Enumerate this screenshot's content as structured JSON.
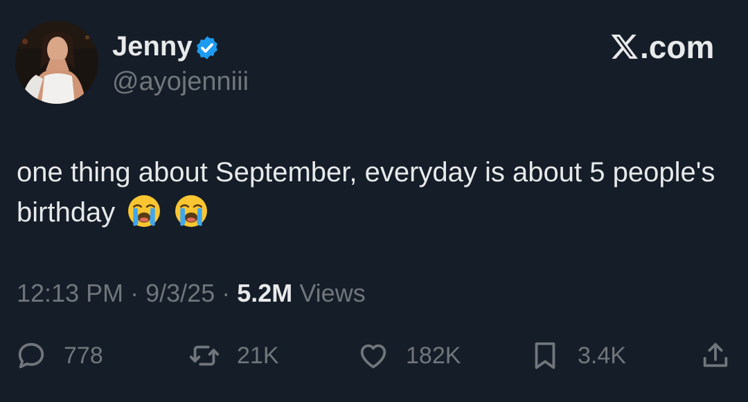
{
  "author": {
    "name": "Jenny",
    "handle": "@ayojenniii"
  },
  "brand": {
    "label": ".com"
  },
  "tweet": {
    "text": "one thing about September, everyday is about 5 people's birthday",
    "emojis": [
      "loudly-crying-face",
      "loudly-crying-face"
    ]
  },
  "meta": {
    "time": "12:13 PM",
    "separator": "·",
    "date": "9/3/25",
    "views_count": "5.2M",
    "views_label": "Views"
  },
  "actions": {
    "replies": "778",
    "reposts": "21K",
    "likes": "182K",
    "bookmarks": "3.4K"
  },
  "colors": {
    "background": "#151d28",
    "text": "#e7e9ea",
    "muted": "#71767b",
    "verified": "#1d9bf0"
  }
}
